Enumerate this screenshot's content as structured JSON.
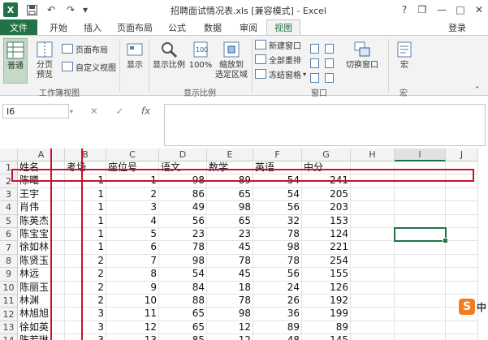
{
  "title": {
    "text": "招聘面试情况表.xls  [兼容模式] - Excel"
  },
  "window": {
    "help": "?",
    "restore": "❐",
    "minimize": "—",
    "maximize": "□",
    "close": "✕"
  },
  "quick_access": {
    "save_icon": "save-icon",
    "undo_icon": "undo-icon",
    "redo_icon": "redo-icon"
  },
  "tabs": {
    "file": "文件",
    "home": "开始",
    "insert": "插入",
    "layout": "页面布局",
    "formulas": "公式",
    "data": "数据",
    "review": "审阅",
    "view": "视图"
  },
  "login": "登录",
  "ribbon": {
    "normal": "普通",
    "page_break": "分页\n预览",
    "page_layout": "页面布局",
    "custom_view": "自定义视图",
    "group_workbook_views": "工作簿视图",
    "show": "显示",
    "zoom": "显示比例",
    "zoom100": "100%",
    "zoom_selection": "缩放到\n选定区域",
    "group_zoom": "显示比例",
    "new_window": "新建窗口",
    "arrange_all": "全部重排",
    "freeze_panes": "冻结窗格",
    "switch_windows": "切换窗口",
    "group_window": "窗口",
    "macros": "宏",
    "group_macros": "宏"
  },
  "formula": {
    "namebox": "I6",
    "cancel": "✕",
    "enter": "✓",
    "fx": "fx",
    "value": ""
  },
  "columns": [
    "A",
    "B",
    "C",
    "D",
    "E",
    "F",
    "G",
    "H",
    "I",
    "J"
  ],
  "header_row": [
    "姓名",
    "考场",
    "座位号",
    "语文",
    "数学",
    "英语",
    "中分"
  ],
  "rows": [
    [
      "陈曦",
      "1",
      "1",
      "98",
      "89",
      "54",
      "241"
    ],
    [
      "王宇",
      "1",
      "2",
      "86",
      "65",
      "54",
      "205"
    ],
    [
      "肖伟",
      "1",
      "3",
      "49",
      "98",
      "56",
      "203"
    ],
    [
      "陈英杰",
      "1",
      "4",
      "56",
      "65",
      "32",
      "153"
    ],
    [
      "陈宝宝",
      "1",
      "5",
      "23",
      "23",
      "78",
      "124"
    ],
    [
      "徐如林",
      "1",
      "6",
      "78",
      "45",
      "98",
      "221"
    ],
    [
      "陈贤玉",
      "2",
      "7",
      "98",
      "78",
      "78",
      "254"
    ],
    [
      "林远",
      "2",
      "8",
      "54",
      "45",
      "56",
      "155"
    ],
    [
      "陈丽玉",
      "2",
      "9",
      "84",
      "18",
      "24",
      "126"
    ],
    [
      "林渊",
      "2",
      "10",
      "88",
      "78",
      "26",
      "192"
    ],
    [
      "林旭旭",
      "3",
      "11",
      "65",
      "98",
      "36",
      "199"
    ],
    [
      "徐如英",
      "3",
      "12",
      "65",
      "12",
      "89",
      "89"
    ],
    [
      "陈若琳",
      "3",
      "13",
      "85",
      "12",
      "48",
      "145"
    ]
  ],
  "watermark": {
    "logo": "S",
    "text": "中"
  }
}
